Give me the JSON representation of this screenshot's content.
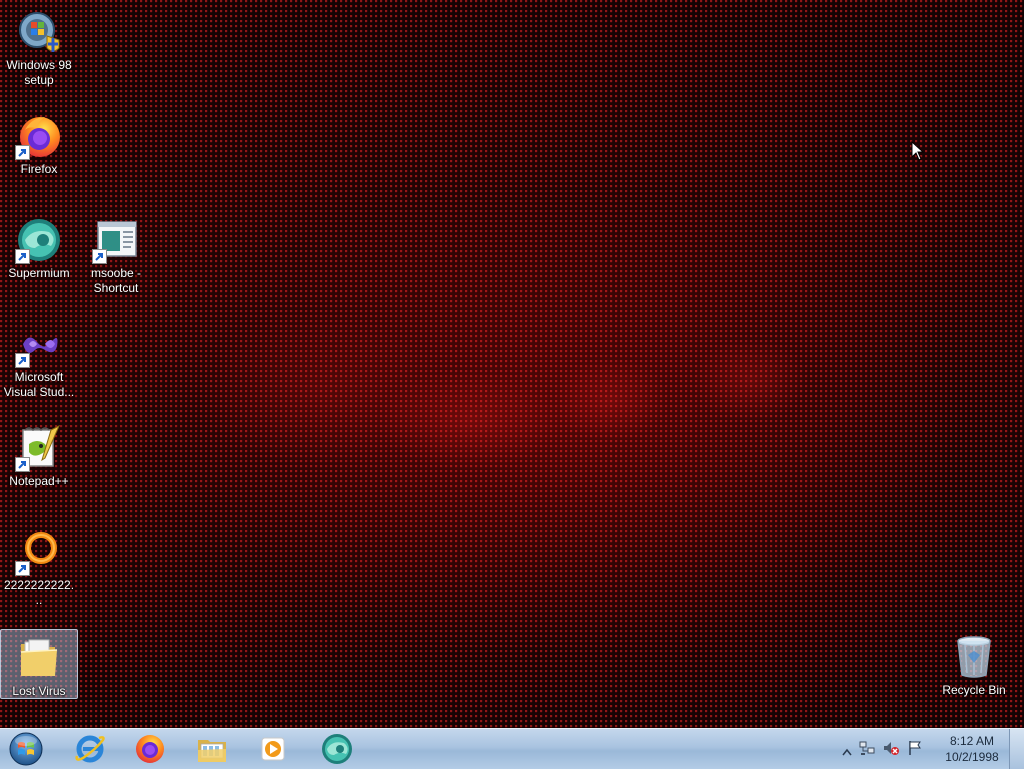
{
  "desktop": {
    "icons": [
      {
        "label": "Windows 98 setup",
        "icon": "setup-icon"
      },
      {
        "label": "Firefox",
        "icon": "firefox-icon"
      },
      {
        "label": "Supermium",
        "icon": "supermium-icon"
      },
      {
        "label": "msoobe - Shortcut",
        "icon": "msoobe-icon"
      },
      {
        "label": "Microsoft Visual Stud...",
        "icon": "visual-studio-icon"
      },
      {
        "label": "Notepad++",
        "icon": "notepad-plus-plus-icon"
      },
      {
        "label": "2222222222...",
        "icon": "ring-app-icon"
      },
      {
        "label": "Lost Virus",
        "icon": "folder-icon"
      },
      {
        "label": "Recycle Bin",
        "icon": "recycle-bin-icon"
      }
    ]
  },
  "taskbar": {
    "pinned": [
      {
        "name": "Internet Explorer",
        "icon": "internet-explorer-icon"
      },
      {
        "name": "Firefox",
        "icon": "firefox-icon"
      },
      {
        "name": "Windows Explorer",
        "icon": "file-explorer-icon"
      },
      {
        "name": "Windows Media Player",
        "icon": "media-player-icon"
      },
      {
        "name": "Supermium",
        "icon": "supermium-icon"
      }
    ],
    "tray": {
      "icons": [
        "show-hidden-icons-arrow",
        "network-icon",
        "volume-muted-icon",
        "action-center-flag-icon"
      ]
    },
    "clock": {
      "time": "8:12 AM",
      "date": "10/2/1998"
    }
  },
  "colors": {
    "wallpaper_base": "#140304",
    "wallpaper_dots": "#ff2828",
    "taskbar": "#a9c3e0"
  }
}
